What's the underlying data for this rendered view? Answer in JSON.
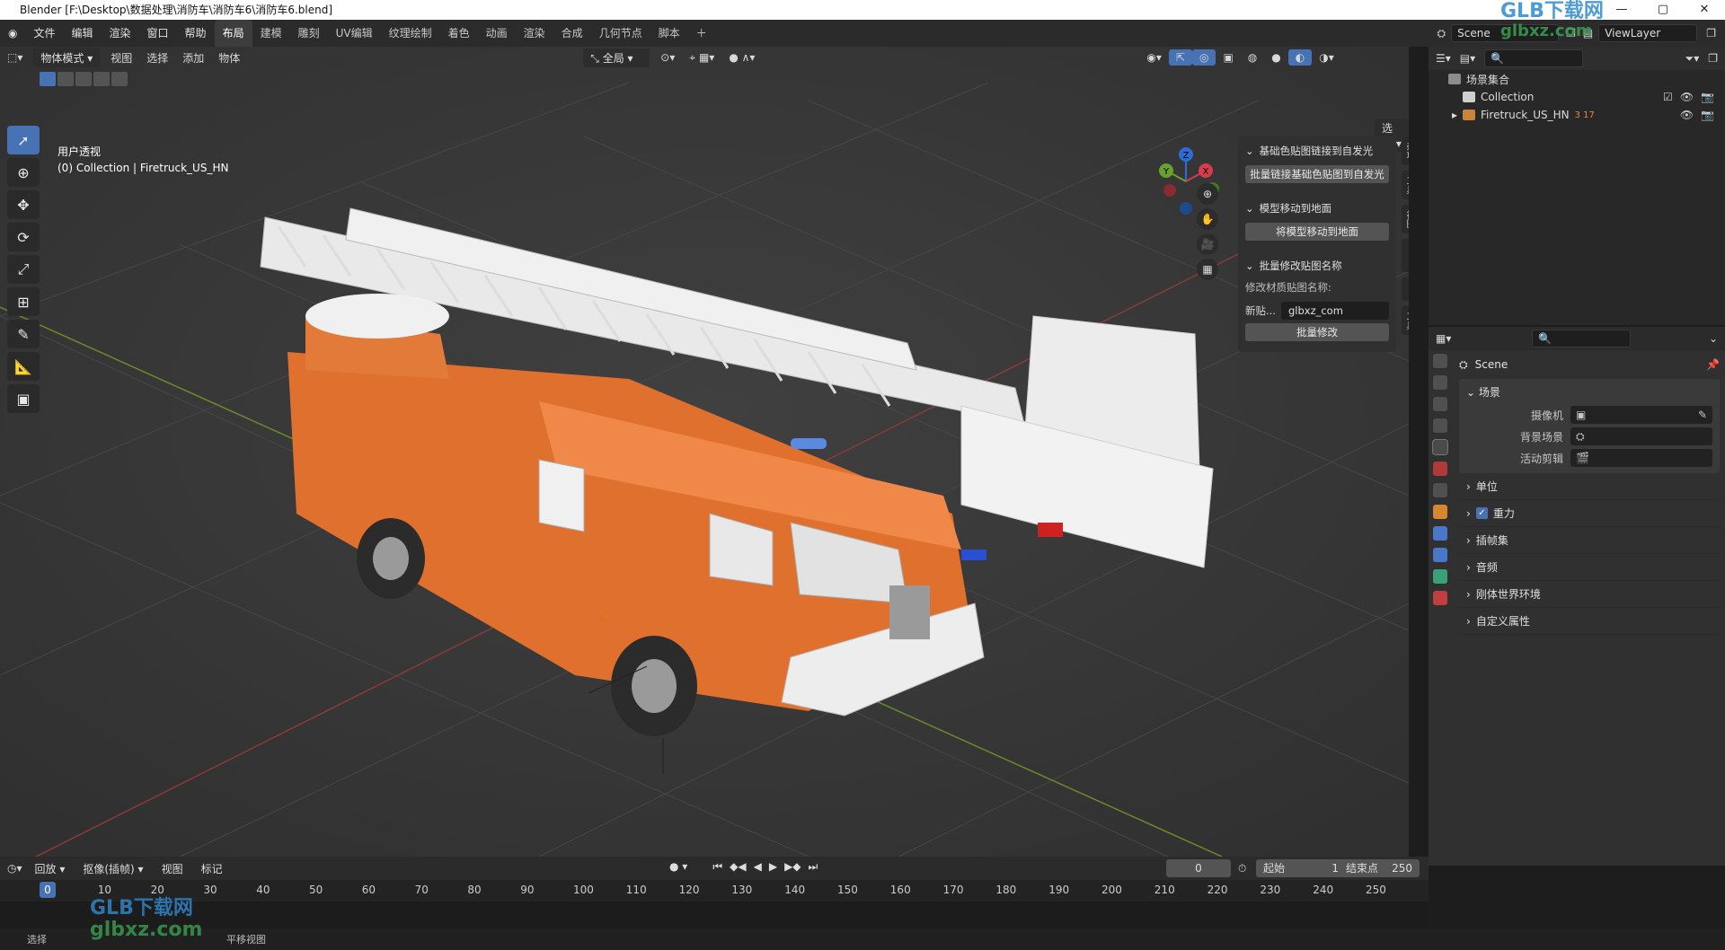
{
  "window": {
    "title": "Blender [F:\\Desktop\\数据处理\\消防车\\消防车6\\消防车6.blend]"
  },
  "menus": [
    "文件",
    "编辑",
    "渲染",
    "窗口",
    "帮助"
  ],
  "workspace_tabs": [
    "布局",
    "建模",
    "雕刻",
    "UV编辑",
    "纹理绘制",
    "着色",
    "动画",
    "渲染",
    "合成",
    "几何节点",
    "脚本"
  ],
  "active_tab": "布局",
  "scene": {
    "name": "Scene",
    "view_layer": "ViewLayer"
  },
  "viewport": {
    "mode": "物体模式",
    "menu": [
      "视图",
      "选择",
      "添加",
      "物体"
    ],
    "transform_orientation": "全局",
    "options_label": "选项",
    "info_line1": "用户透视",
    "info_line2": "(0) Collection | Firetruck_US_HN",
    "gizmo_axes": [
      "X",
      "Y",
      "Z"
    ]
  },
  "npanel": {
    "sec1_title": "基础色贴图链接到自发光",
    "sec1_button": "批量链接基础色贴图到自发光",
    "sec2_title": "模型移动到地面",
    "sec2_button": "将模型移动到地面",
    "sec3_title": "批量修改贴图名称",
    "sec3_label": "修改材质贴图名称:",
    "sec3_field_label": "新贴...",
    "sec3_field_value": "glbxz_com",
    "sec3_button": "批量修改",
    "tabs": [
      "杂项",
      "工具",
      "视图",
      "MMD",
      "LM",
      "工具"
    ]
  },
  "outliner": {
    "root": "场景集合",
    "items": [
      {
        "name": "Collection"
      },
      {
        "name": "Firetruck_US_HN",
        "counts": "3 17"
      }
    ]
  },
  "properties": {
    "context_title": "Scene",
    "panel_title": "场景",
    "fields": [
      {
        "label": "摄像机",
        "value": ""
      },
      {
        "label": "背景场景",
        "value": ""
      },
      {
        "label": "活动剪辑",
        "value": ""
      }
    ],
    "collapsed_panels": [
      "单位",
      "重力",
      "插帧集",
      "音频",
      "刚体世界环境",
      "自定义属性"
    ]
  },
  "timeline": {
    "menus": [
      "回放",
      "抠像(插帧)",
      "视图",
      "标记"
    ],
    "current_frame": "0",
    "start_label": "起始",
    "start": "1",
    "end_label": "结束点",
    "end": "250",
    "ruler": [
      "0",
      "10",
      "20",
      "30",
      "40",
      "50",
      "60",
      "70",
      "80",
      "90",
      "100",
      "110",
      "120",
      "130",
      "140",
      "150",
      "160",
      "170",
      "180",
      "190",
      "200",
      "210",
      "220",
      "230",
      "240",
      "250"
    ]
  },
  "statusbar": {
    "left": "选择",
    "mid": "平移视图"
  },
  "watermarks": [
    "GLB下载网",
    "glbxz.com"
  ],
  "colors": {
    "accent": "#4772b3",
    "truck_orange": "#e0702e",
    "viewport_bg": "#393939"
  }
}
